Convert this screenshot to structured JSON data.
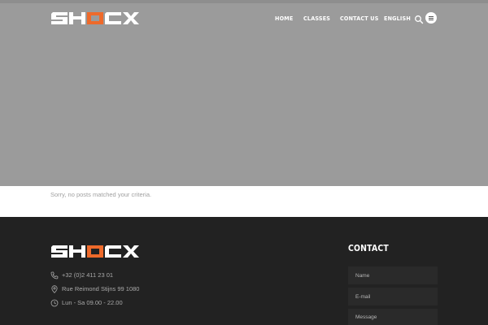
{
  "brand": {
    "name": "SHOCX",
    "accent_color": "#ee6a2b"
  },
  "nav": {
    "items": [
      {
        "label": "HOME"
      },
      {
        "label": "CLASSES"
      },
      {
        "label": "CONTACT US"
      },
      {
        "label": "ENGLISH"
      }
    ],
    "search_icon": "search-icon",
    "menu_icon": "hamburger-menu-icon"
  },
  "main": {
    "empty_message": "Sorry, no posts matched your criteria."
  },
  "footer": {
    "contact_info": [
      {
        "icon": "phone-icon",
        "text": "+32 (0)2 411 23 01"
      },
      {
        "icon": "location-pin-icon",
        "text": "Rue Reimond Stijns 99 1080"
      },
      {
        "icon": "clock-icon",
        "text": "Lun - Sa 09.00 - 22.00"
      }
    ],
    "contact_form": {
      "title": "CONTACT",
      "name_placeholder": "Name",
      "email_placeholder": "E-mail",
      "message_placeholder": "Message"
    }
  },
  "colors": {
    "hero_bg": "#9b9b9b",
    "footer_bg": "#222222",
    "field_bg": "#2a2a2a"
  }
}
